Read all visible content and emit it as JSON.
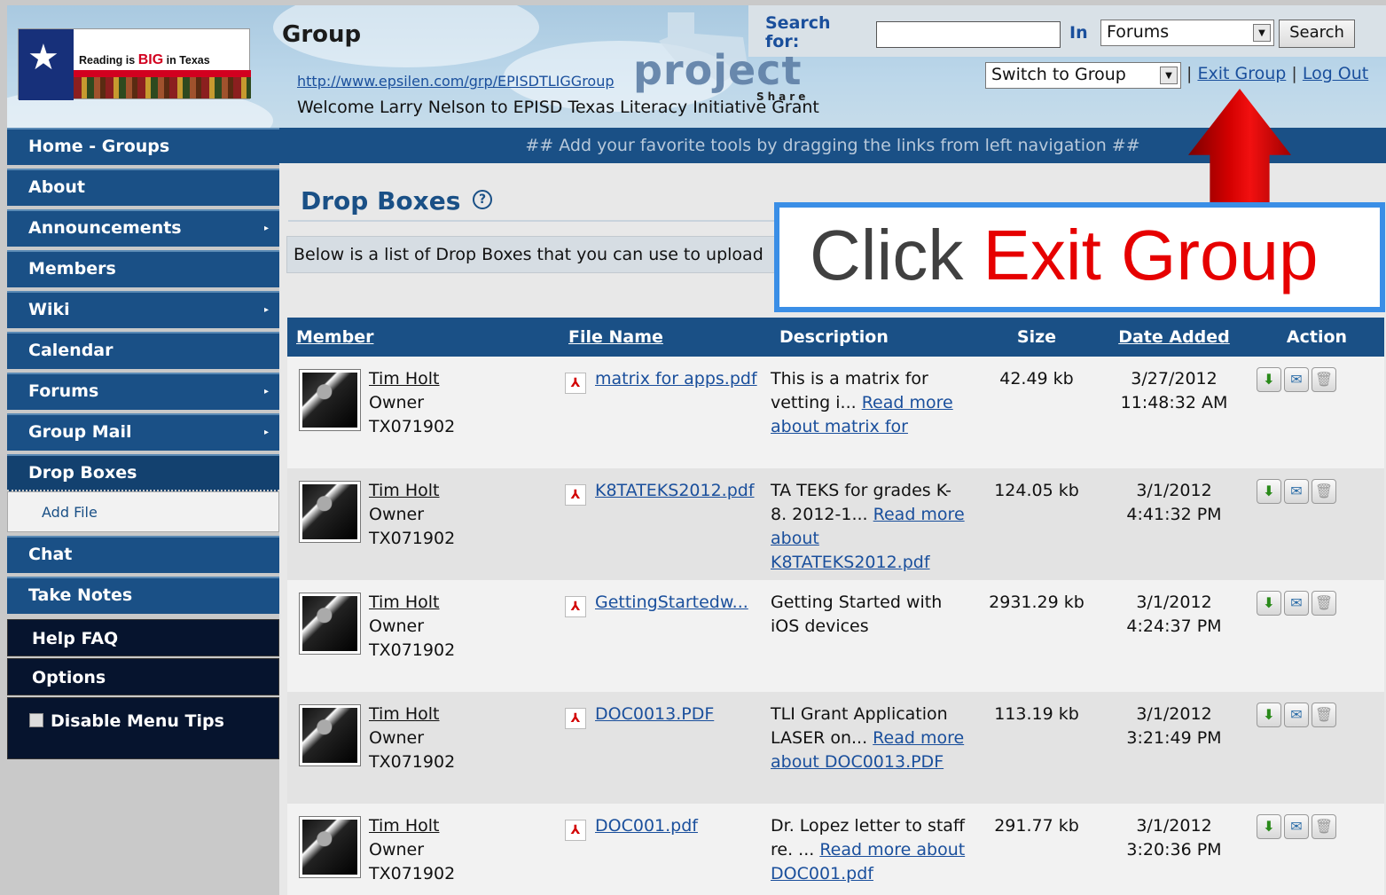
{
  "header": {
    "logo_text_prefix": "Reading is ",
    "logo_text_big": "BIG",
    "logo_text_suffix": " in Texas",
    "group_title": "Group",
    "group_url": "http://www.epsilen.com/grp/EPISDTLIGGroup",
    "welcome": "Welcome Larry Nelson to EPISD Texas Literacy Initiative Grant",
    "project_logo": "project",
    "project_share": "Share",
    "search_label_line1": "Search",
    "search_label_line2": "for:",
    "search_value": "",
    "in_label": "In",
    "search_scope": "Forums",
    "search_button": "Search",
    "switch_select": "Switch to Group",
    "exit_group": "Exit Group",
    "log_out": "Log Out",
    "separator": "|"
  },
  "sidebar": {
    "items": [
      {
        "label": "Home - Groups",
        "submenu": false
      },
      {
        "label": "About",
        "submenu": false
      },
      {
        "label": "Announcements",
        "submenu": true
      },
      {
        "label": "Members",
        "submenu": false
      },
      {
        "label": "Wiki",
        "submenu": true
      },
      {
        "label": "Calendar",
        "submenu": false
      },
      {
        "label": "Forums",
        "submenu": true
      },
      {
        "label": "Group Mail",
        "submenu": true
      },
      {
        "label": "Drop Boxes",
        "submenu": false,
        "active": true
      }
    ],
    "sub_item": "Add File",
    "items_after": [
      {
        "label": "Chat"
      },
      {
        "label": "Take Notes"
      }
    ],
    "help_faq": "Help FAQ",
    "options": "Options",
    "disable_tips": "Disable Menu Tips"
  },
  "main": {
    "tip_bar": "## Add your favorite tools by dragging the links from left navigation ##",
    "page_title": "Drop Boxes",
    "help_icon": "?",
    "intro": "Below is a list of Drop Boxes that you can use to upload",
    "table": {
      "headers": [
        "Member",
        "File Name",
        "Description",
        "Size",
        "Date Added",
        "Action"
      ],
      "rows": [
        {
          "member": "Tim Holt",
          "role": "Owner",
          "id": "TX071902",
          "file": "matrix for apps.pdf",
          "desc": "This is a matrix for vetting i...",
          "read_more": "Read more about matrix for",
          "size": "42.49 kb",
          "date": "3/27/2012",
          "time": "11:48:32 AM"
        },
        {
          "member": "Tim Holt",
          "role": "Owner",
          "id": "TX071902",
          "file": "K8TATEKS2012.pdf",
          "desc": "TA TEKS for grades K-8. 2012-1...",
          "read_more": "Read more about K8TATEKS2012.pdf",
          "size": "124.05 kb",
          "date": "3/1/2012",
          "time": "4:41:32 PM"
        },
        {
          "member": "Tim Holt",
          "role": "Owner",
          "id": "TX071902",
          "file": "GettingStartedw...",
          "desc": "Getting Started with iOS devices",
          "read_more": "",
          "size": "2931.29 kb",
          "date": "3/1/2012",
          "time": "4:24:37 PM"
        },
        {
          "member": "Tim Holt",
          "role": "Owner",
          "id": "TX071902",
          "file": "DOC0013.PDF",
          "desc": "TLI Grant Application LASER on...",
          "read_more": "Read more about DOC0013.PDF",
          "size": "113.19 kb",
          "date": "3/1/2012",
          "time": "3:21:49 PM"
        },
        {
          "member": "Tim Holt",
          "role": "Owner",
          "id": "TX071902",
          "file": "DOC001.pdf",
          "desc": "Dr. Lopez letter to staff re. ...",
          "read_more": "Read more about DOC001.pdf",
          "size": "291.77 kb",
          "date": "3/1/2012",
          "time": "3:20:36 PM"
        }
      ]
    }
  },
  "annotation": {
    "callout_prefix": "Click ",
    "callout_highlight": "Exit Group",
    "highlight_color": "#e60000",
    "border_color": "#3a8ee6",
    "arrow_color": "#d30000"
  }
}
